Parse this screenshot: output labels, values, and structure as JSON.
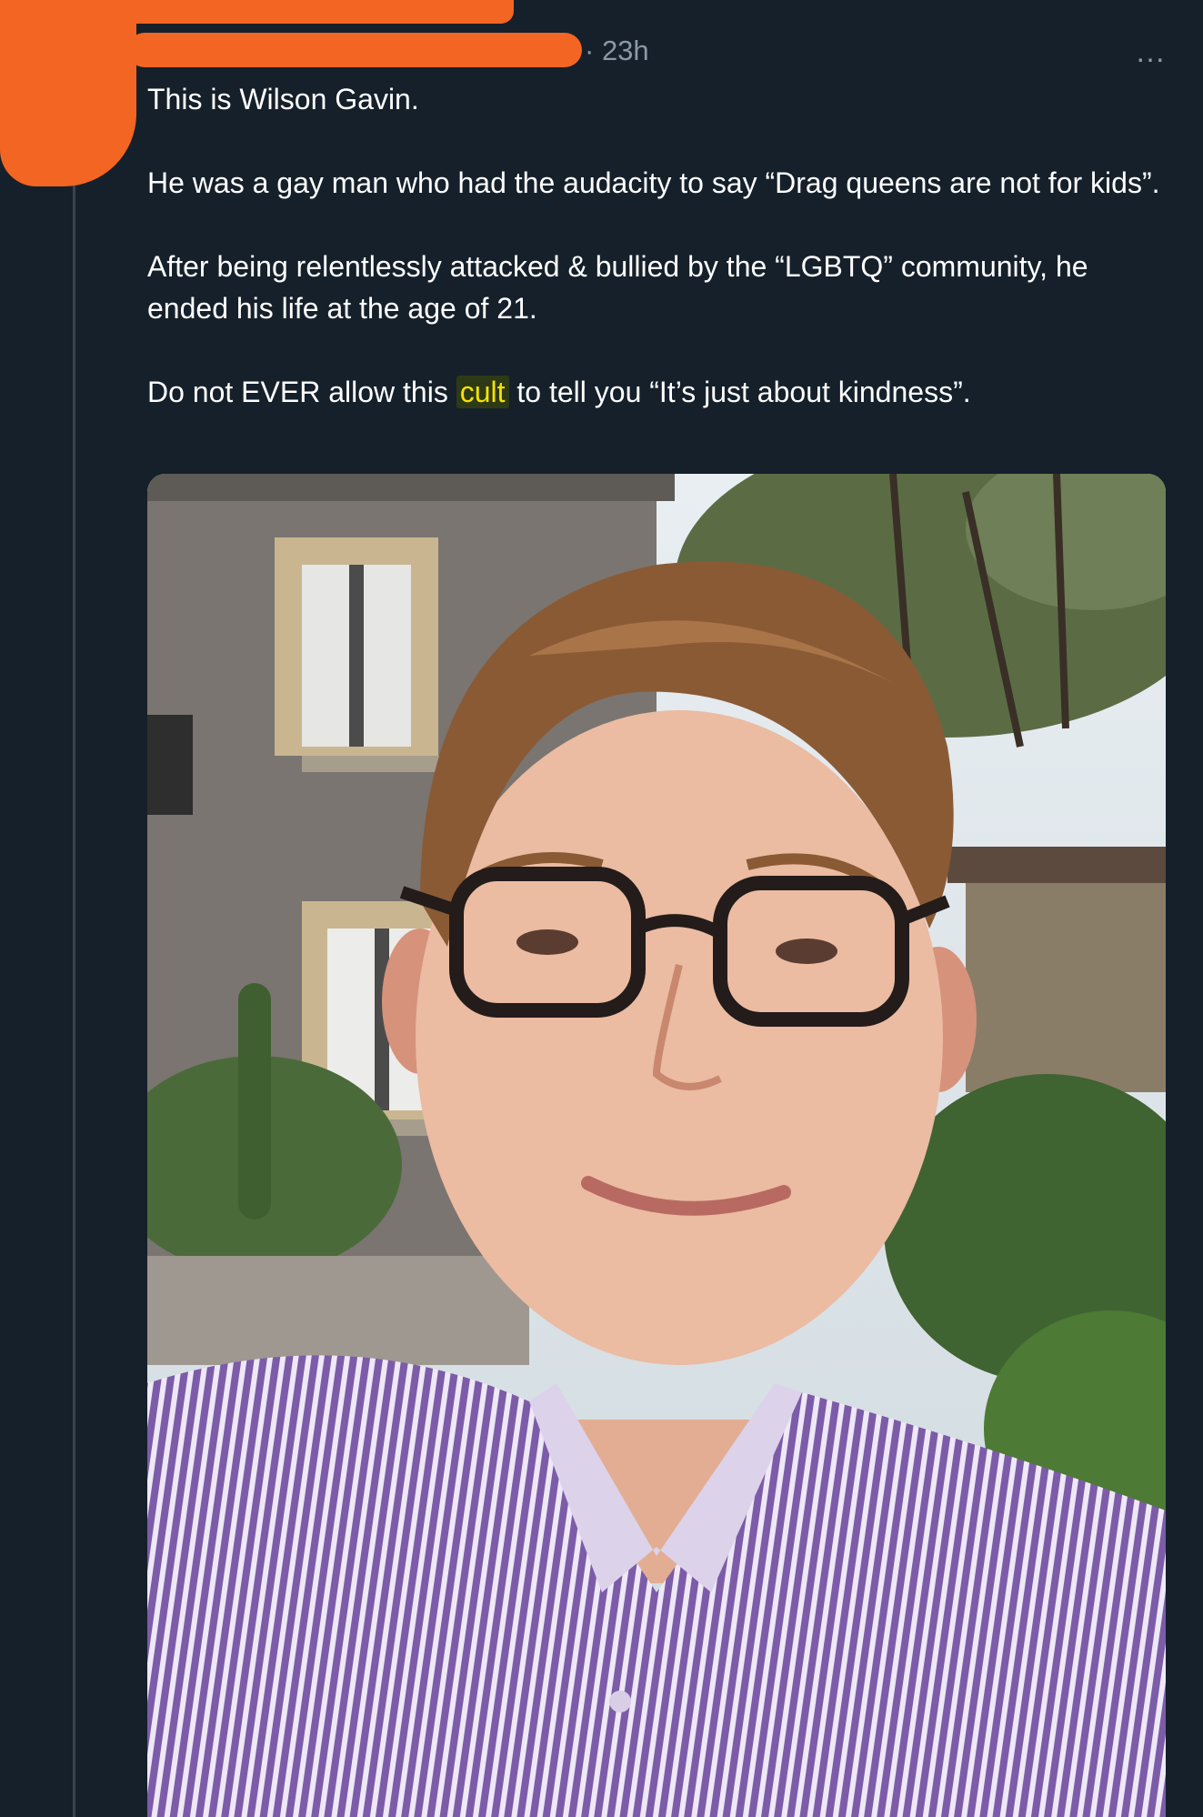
{
  "tweet": {
    "timestamp": "23h",
    "more_label": "…",
    "paragraphs": {
      "p1": "This is Wilson Gavin.",
      "p2": "He was a gay man who had the audacity to say “Drag queens are not for kids”.",
      "p3": "After being relentlessly attacked & bullied by the “LGBTQ” community, he ended his life at the age of 21.",
      "p4_before": "Do not EVER allow this ",
      "p4_highlight": "cult",
      "p4_after": " to tell you “It’s just about kindness”."
    },
    "media": {
      "description_icon": "photo"
    }
  },
  "colors": {
    "background": "#15202b",
    "secondary_text": "#8b98a5",
    "redaction": "#f26522",
    "highlight_text": "#f5e300"
  }
}
